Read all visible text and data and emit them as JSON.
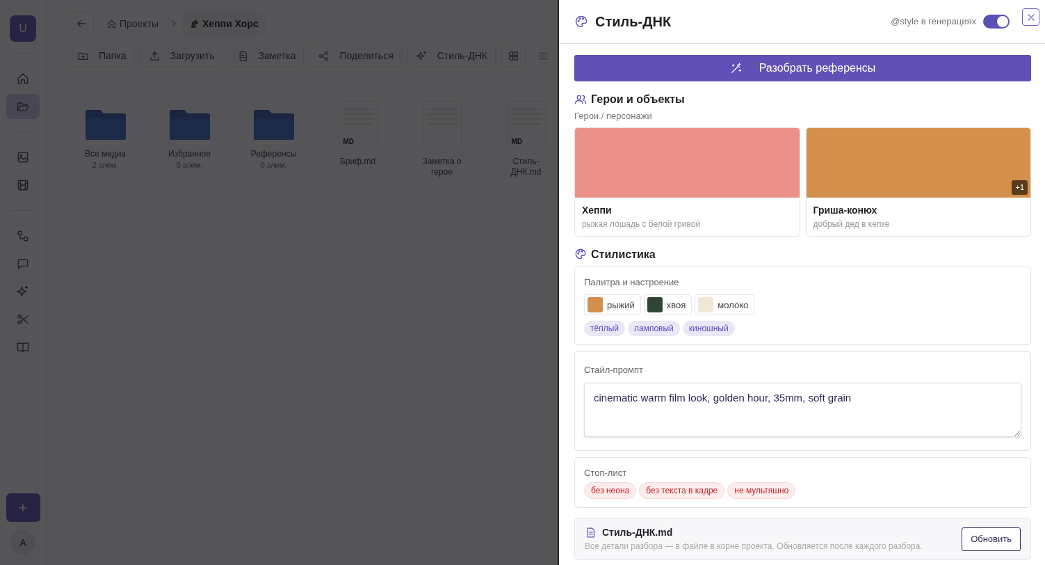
{
  "sidebar": {
    "logo": "U",
    "nav": [
      {
        "selected": false
      },
      {
        "selected": true
      },
      {
        "selected": false
      },
      {
        "selected": false
      },
      {
        "selected": false
      },
      {
        "selected": false
      },
      {
        "selected": false
      },
      {
        "selected": false
      },
      {
        "selected": false
      }
    ],
    "add_label": "+",
    "avatar": "A"
  },
  "breadcrumbs": [
    {
      "label": "Проекты",
      "selected": false
    },
    {
      "label": "Хеппи Хорс",
      "selected": true
    }
  ],
  "toolbar": [
    "Папка",
    "Загрузить",
    "Заметка",
    "Поделиться",
    "Стиль-ДНК"
  ],
  "files": [
    {
      "kind": "folder",
      "name": "Все медиа",
      "meta": "2 элем."
    },
    {
      "kind": "folder",
      "name": "Избранное",
      "meta": "0 элем."
    },
    {
      "kind": "folder",
      "name": "Референсы",
      "meta": "0 элем."
    },
    {
      "kind": "doc",
      "name": "Бриф.md",
      "badge": "MD"
    },
    {
      "kind": "doc",
      "name": "Заметка о герое"
    },
    {
      "kind": "doc",
      "name": "Стиль-ДНК.md",
      "badge": "MD"
    }
  ],
  "panel": {
    "title": "Стиль-ДНК",
    "toggle_label": "@style в генерациях",
    "toggle_on": true,
    "analyze_button": "Разобрать референсы",
    "heroes_title": "Герои и объекты",
    "heroes_subtitle": "Герои / персонажи",
    "heroes": [
      {
        "name": "Хеппи",
        "description": "рыжая лошадь с белой гривой",
        "color": "#ec918a"
      },
      {
        "name": "Гриша-конюх",
        "description": "добрый дед в кепке",
        "color": "#d3904d",
        "more": "+1"
      }
    ],
    "style_title": "Стилистика",
    "palette_title": "Палитра и настроение",
    "palette": [
      {
        "name": "рыжий",
        "color": "#d3904d"
      },
      {
        "name": "хвоя",
        "color": "#2f4538"
      },
      {
        "name": "молоко",
        "color": "#f1e8d8"
      }
    ],
    "moods": [
      "тёплый",
      "ламповый",
      "киношный"
    ],
    "prompt_title": "Стайл-промпт",
    "prompt": "cinematic warm film look, golden hour, 35mm, soft grain",
    "stop_title": "Стоп-лист",
    "stop": [
      "без неона",
      "без текста в кадре",
      "не мультяшно"
    ],
    "file_name": "Стиль-ДНК.md",
    "file_note": "Все детали разбора — в файле в корне проекта. Обновляется после каждого разбора.",
    "refresh_button": "Обновить"
  }
}
